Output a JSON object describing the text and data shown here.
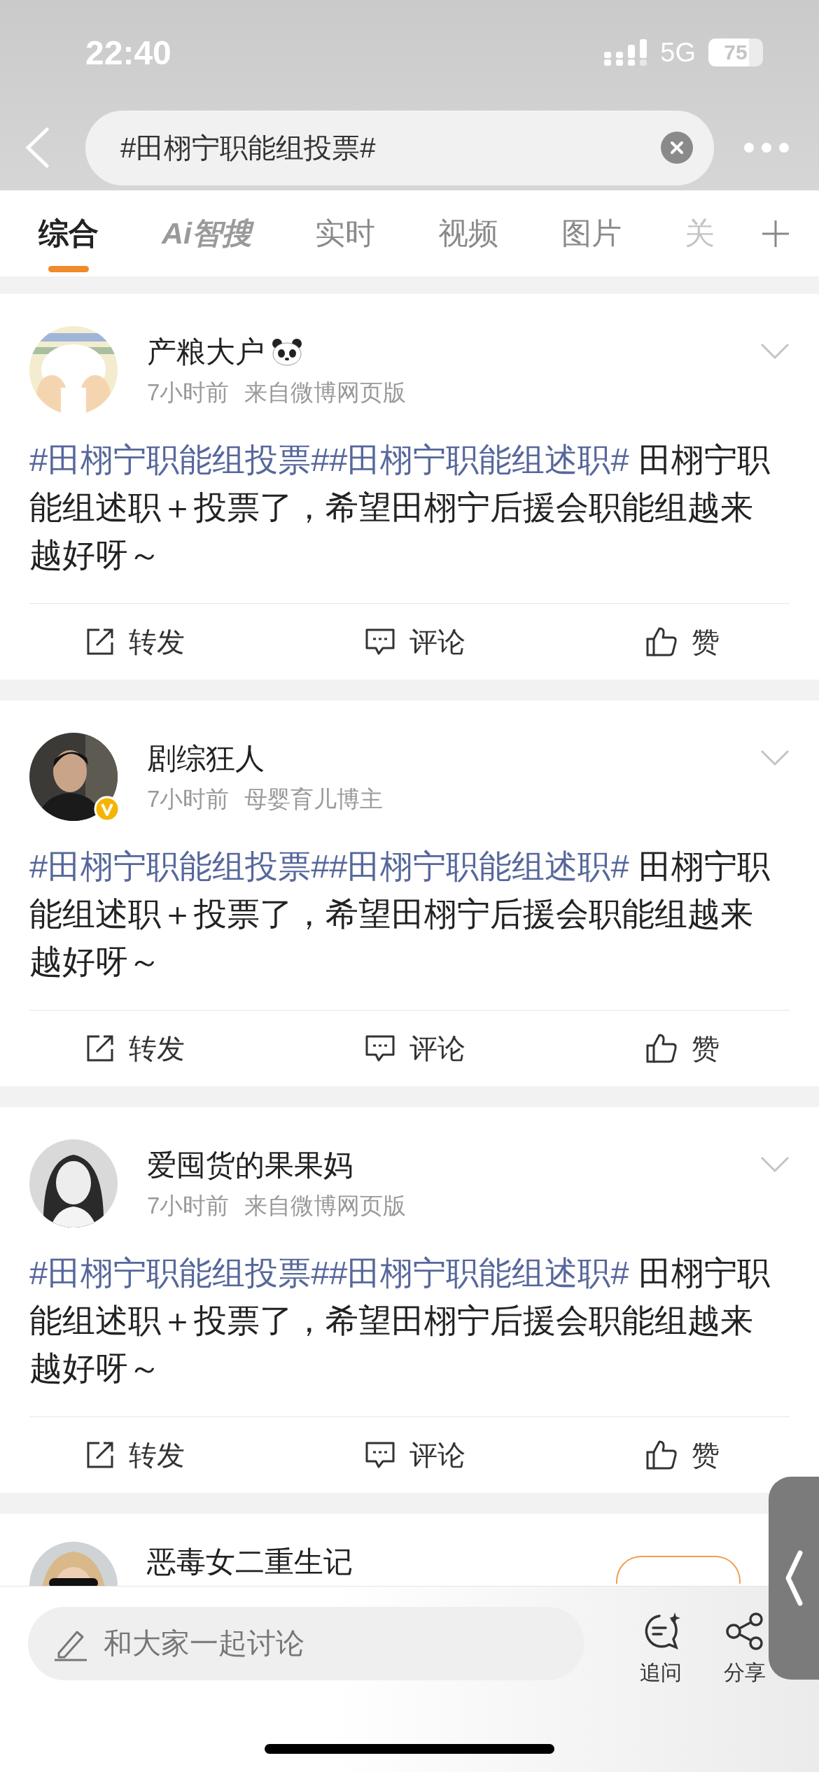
{
  "status_bar": {
    "time": "22:40",
    "network": "5G",
    "battery": "75"
  },
  "search": {
    "value": "#田栩宁职能组投票#"
  },
  "tabs": [
    {
      "label": "综合",
      "selected": true,
      "kind": "text"
    },
    {
      "label": "Ai智搜",
      "selected": false,
      "kind": "ai"
    },
    {
      "label": "实时",
      "selected": false,
      "kind": "text"
    },
    {
      "label": "视频",
      "selected": false,
      "kind": "text"
    },
    {
      "label": "图片",
      "selected": false,
      "kind": "text"
    },
    {
      "label": "关",
      "selected": false,
      "kind": "text"
    }
  ],
  "posts": [
    {
      "author": "产粮大户",
      "has_emoji": true,
      "verified": false,
      "time": "7小时前",
      "source": "来自微博网页版",
      "segments": [
        {
          "kind": "topic",
          "text": "#田栩宁职能组投票#"
        },
        {
          "kind": "topic",
          "text": "#田栩宁职能组述职#"
        },
        {
          "kind": "plain",
          "text": " 田栩宁职能组述职＋投票了，希望田栩宁后援会职能组越来越好呀～"
        }
      ],
      "actions": [
        {
          "kind": "repost",
          "label": "转发"
        },
        {
          "kind": "comment",
          "label": "评论"
        },
        {
          "kind": "like",
          "label": "赞"
        }
      ]
    },
    {
      "author": "剧综狂人",
      "has_emoji": false,
      "verified": true,
      "time": "7小时前",
      "source": "母婴育儿博主",
      "segments": [
        {
          "kind": "topic",
          "text": "#田栩宁职能组投票#"
        },
        {
          "kind": "topic",
          "text": "#田栩宁职能组述职#"
        },
        {
          "kind": "plain",
          "text": " 田栩宁职能组述职＋投票了，希望田栩宁后援会职能组越来越好呀～"
        }
      ],
      "actions": [
        {
          "kind": "repost",
          "label": "转发"
        },
        {
          "kind": "comment",
          "label": "评论"
        },
        {
          "kind": "like",
          "label": "赞"
        }
      ]
    },
    {
      "author": "爱囤货的果果妈",
      "has_emoji": false,
      "verified": false,
      "time": "7小时前",
      "source": "来自微博网页版",
      "segments": [
        {
          "kind": "topic",
          "text": "#田栩宁职能组投票#"
        },
        {
          "kind": "topic",
          "text": "#田栩宁职能组述职#"
        },
        {
          "kind": "plain",
          "text": " 田栩宁职能组述职＋投票了，希望田栩宁后援会职能组越来越好呀～"
        }
      ],
      "actions": [
        {
          "kind": "repost",
          "label": "转发"
        },
        {
          "kind": "comment",
          "label": "评论"
        },
        {
          "kind": "like",
          "label": "赞"
        }
      ]
    }
  ],
  "next_post": {
    "author": "恶毒女二重生记"
  },
  "comment_bar": {
    "placeholder": "和大家一起讨论",
    "actions": [
      {
        "kind": "ask",
        "label": "追问"
      },
      {
        "kind": "share",
        "label": "分享"
      }
    ]
  }
}
